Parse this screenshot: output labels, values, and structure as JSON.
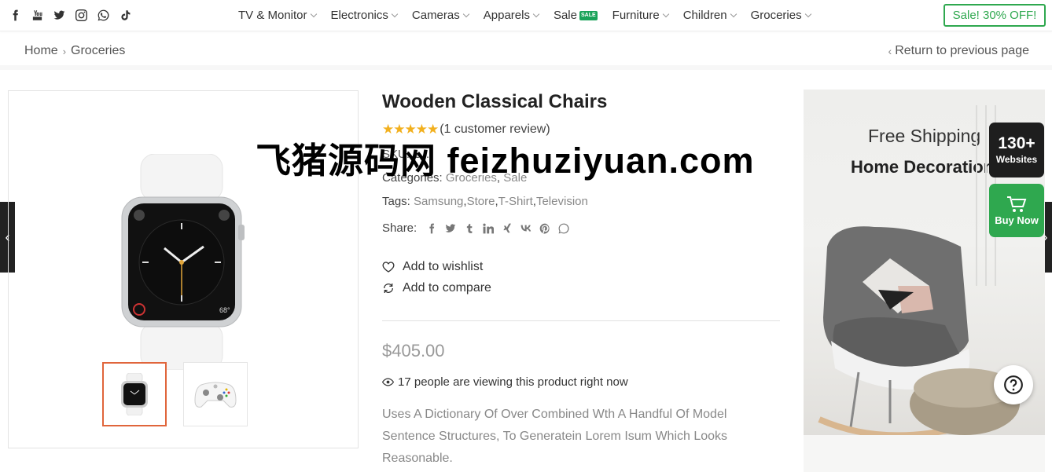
{
  "colors": {
    "accent_green": "#2fa84f",
    "sale_badge": "#1aa35a",
    "star": "#f2b01e",
    "active_thumb_border": "#e0653b"
  },
  "header": {
    "socials": [
      "facebook-icon",
      "youtube-icon",
      "twitter-icon",
      "instagram-icon",
      "whatsapp-icon",
      "tiktok-icon"
    ],
    "nav": [
      {
        "label": "TV & Monitor"
      },
      {
        "label": "Electronics"
      },
      {
        "label": "Cameras"
      },
      {
        "label": "Apparels"
      },
      {
        "label": "Sale",
        "badge": "SALE"
      },
      {
        "label": "Furniture"
      },
      {
        "label": "Children"
      },
      {
        "label": "Groceries"
      }
    ],
    "promo_button": "Sale! 30% OFF!"
  },
  "breadcrumb": {
    "items": [
      "Home",
      "Groceries"
    ],
    "back_link": "Return to previous page"
  },
  "product": {
    "title": "Wooden Classical Chairs",
    "rating_stars": 5,
    "review_text": "(1 customer review)",
    "sku_label": "SKU:",
    "sku_value": "1...",
    "categories_label": "Categories:",
    "categories": [
      "Groceries",
      "Sale"
    ],
    "tags_label": "Tags:",
    "tags": [
      "Samsung",
      "Store",
      "T-Shirt",
      "Television"
    ],
    "share_label": "Share:",
    "share_icons": [
      "facebook-icon",
      "twitter-icon",
      "tumblr-icon",
      "linkedin-icon",
      "xing-icon",
      "vk-icon",
      "pinterest-icon",
      "whatsapp-icon"
    ],
    "wishlist": "Add to wishlist",
    "compare": "Add to compare",
    "price": "$405.00",
    "viewing": "17 people are viewing this product right now",
    "description": "Uses A Dictionary Of Over Combined Wth A Handful Of Model Sentence Structures, To Generatein Lorem Isum Which Looks Reasonable."
  },
  "banner": {
    "title": "Free Shipping",
    "subtitle": "Home Decoration"
  },
  "floating": {
    "websites_count": "130+",
    "websites_label": "Websites",
    "buy_now": "Buy Now"
  },
  "watermark": "飞猪源码网 feizhuziyuan.com"
}
